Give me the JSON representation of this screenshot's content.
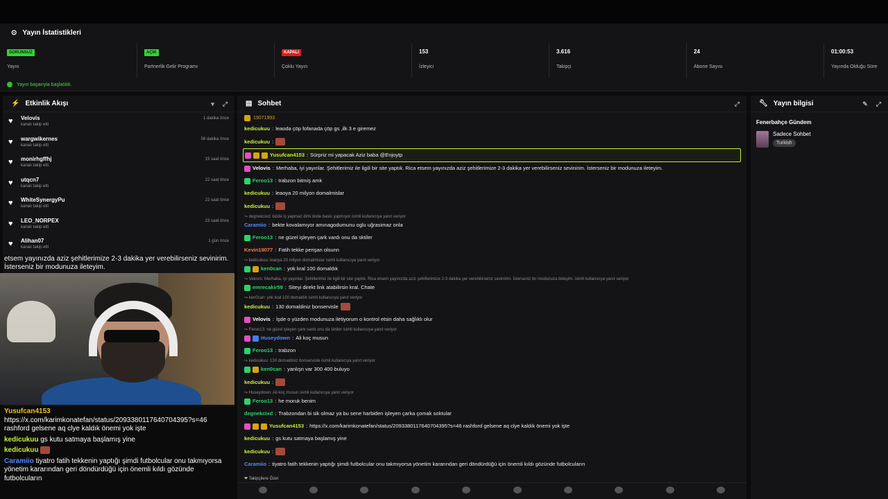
{
  "stats": {
    "title": "Yayın İstatistikleri",
    "items": [
      {
        "badge": "SORUNSUZ",
        "badge_color": "#36d336",
        "label": "Yayın"
      },
      {
        "badge": "AÇIK",
        "badge_color": "#36d336",
        "label": "Partnerlik Gelir Programı"
      },
      {
        "badge": "KAPALI",
        "badge_color": "#d92020",
        "label": "Çoklu Yayın"
      },
      {
        "value": "153",
        "label": "İzleyici"
      },
      {
        "value": "3.616",
        "label": "Takipçi"
      },
      {
        "value": "24",
        "label": "Abone Sayısı"
      },
      {
        "value": "01:00:53",
        "label": "Yayında Olduğu Süre"
      }
    ],
    "status": "Yayın başarıyla başlatıldı."
  },
  "activity": {
    "title": "Etkinlik Akışı",
    "items": [
      {
        "name": "Velovis",
        "sub": "kanalı takip etti",
        "time": "1 dakika önce"
      },
      {
        "name": "wargwikernes",
        "sub": "kanalı takip etti",
        "time": "56 dakika önce"
      },
      {
        "name": "monirhgffhj",
        "sub": "kanalı takip etti",
        "time": "15 saat önce"
      },
      {
        "name": "utqcn7",
        "sub": "kanalı takip etti",
        "time": "22 saat önce"
      },
      {
        "name": "WhiteSynergyPu",
        "sub": "kanalı takip etti",
        "time": "22 saat önce"
      },
      {
        "name": "LEO_NORPEX",
        "sub": "kanalı takip etti",
        "time": "23 saat önce"
      },
      {
        "name": "Alihan07",
        "sub": "kanalı takip etti",
        "time": "1 gün önce"
      }
    ]
  },
  "overlay": {
    "alert_text": "etsem yayınızda aziz şehitlerimize 2-3 dakika yer verebilirseniz sevinirim. İsterseniz bir modunuza ileteyim.",
    "chat": [
      {
        "user": "Yusufcan4153",
        "color": "#f0c419",
        "text": "https://x.com/karimkonatefan/status/2093380117640704395?s=46 rashford gelsene aq clye kaldık önemi yok işte"
      },
      {
        "user": "kedicukuu",
        "color": "#c7f03c",
        "text": "gs kutu satmaya başlamış yine"
      },
      {
        "user": "kedicukuu",
        "color": "#c7f03c",
        "text": ""
      },
      {
        "user": "Caramiio",
        "color": "#4e8cff",
        "text": "tiyatro fatih tekkenin yaptığı şimdi futbolcular onu takmıyorsa yönetim kararından geri döndürdüğü için önemli kıldı gözünde futbolcuların"
      }
    ]
  },
  "chat": {
    "title": "Sohbet",
    "pinned": "19071993",
    "messages": [
      {
        "user": "kedicukuu",
        "color": "#c7f03c",
        "text": "leaoda çöp fofanada çöp gs ,ilk 3 e giremez"
      },
      {
        "user": "kedicukuu",
        "color": "#c7f03c",
        "text": "",
        "emote": true
      },
      {
        "user": "Yusufcan4153",
        "color": "#c7f03c",
        "text": "Sürpriz mi yapacak Aziz baba @Enjoytp",
        "highlight": true,
        "badges": [
          "vip",
          "gift",
          "gift"
        ]
      },
      {
        "user": "Velovis",
        "color": "#ffffff",
        "text": "Merhaba, iyi yayınlar. Şehitlerimiz ile ilgili bir site yaptık. Rica etsem yayınızda aziz şehitlerimize 2-3 dakika yer verebilirseniz sevinirim. İsterseniz bir modunuza ileteyim.",
        "badges": [
          "vip"
        ]
      },
      {
        "user": "Feroo13",
        "color": "#2dd36a",
        "text": "trabzon bitmiş amk",
        "badges": [
          "mod"
        ]
      },
      {
        "user": "kedicukuu",
        "color": "#c7f03c",
        "text": "leaoya 20 milyon domalmislar"
      },
      {
        "user": "kedicukuu",
        "color": "#c7f03c",
        "text": "",
        "emote": true
      },
      {
        "reply": "degnekcixd: bizde iş yapmaz dimi önde baskı yapmıyor isimli kullanıcıya yanıt veriyor"
      },
      {
        "user": "Caramiio",
        "color": "#4e8cff",
        "text": "bekte kovalamıyor amınagodumunu oglu uğrasimaz onla"
      },
      {
        "user": "Feroo13",
        "color": "#2dd36a",
        "text": "ne güzel işleyen çark vardı onu da sktiler",
        "badges": [
          "mod"
        ]
      },
      {
        "user": "Kevin19077",
        "color": "#ff7a4a",
        "text": "Fatih tekke perişan olsunn"
      },
      {
        "reply": "kedicukuu: leaoya 20 milyon domalmislar isimli kullanıcıya yanıt veriyor"
      },
      {
        "user": "ken0can",
        "color": "#2dd36a",
        "text": "yok kral 100 domaldık",
        "badges": [
          "mod",
          "gift"
        ]
      },
      {
        "reply": "Velovis: Merhaba, iyi yayınlar. Şehitlerimiz ile ilgili bir site yaptık. Rica etsem yayınızda aziz şehitlerimize 2-3 dakika yer verebilirseniz sevinirim. İsterseniz bir modunuza ileteyim. isimli kullanıcıya yanıt veriyor"
      },
      {
        "user": "emrecakir59",
        "color": "#2dd36a",
        "text": "Siteyi direkt link atabilirsin kral. Chate",
        "badges": [
          "mod"
        ]
      },
      {
        "reply": "ken0can: yok kral 100 domaldık isimli kullanıcıya yanıt veriyor"
      },
      {
        "user": "kedicukuu",
        "color": "#c7f03c",
        "text": "130 domaldiniz bonservisle",
        "emote": true
      },
      {
        "user": "Velovis",
        "color": "#ffffff",
        "text": "İşde o yüzden modunuza iletiyorum o kontrol etsin daha sağlıklı olur",
        "badges": [
          "vip"
        ]
      },
      {
        "reply": "Feroo13: ne güzel işleyen çark vardı onu da sktiler isimli kullanıcıya yanıt veriyor"
      },
      {
        "user": "Huseydown",
        "color": "#4e8cff",
        "text": "Ali koç musun",
        "badges": [
          "vip",
          "sub"
        ]
      },
      {
        "user": "Feroo13",
        "color": "#2dd36a",
        "text": "trabzon",
        "badges": [
          "mod"
        ]
      },
      {
        "reply": "kedicukuu: 130 domaldiniz bonservisle isimli kullanıcıya yanıt veriyor"
      },
      {
        "user": "ken0can",
        "color": "#2dd36a",
        "text": "yanlışn var 300 400 buluyo",
        "badges": [
          "mod",
          "gift"
        ]
      },
      {
        "user": "kedicukuu",
        "color": "#c7f03c",
        "text": "",
        "emote": true
      },
      {
        "reply": "Huseydown: Ali koç musun isimli kullanıcıya yanıt veriyor"
      },
      {
        "user": "Feroo13",
        "color": "#2dd36a",
        "text": "he moruk benim",
        "badges": [
          "mod"
        ]
      },
      {
        "user": "degnekcixd",
        "color": "#2dd36a",
        "text": "Trabzondan bi sik olmaz ya bu sene harbiden işleyen çarka çomak soktular"
      },
      {
        "user": "Yusufcan4153",
        "color": "#c7f03c",
        "text": "https://x.com/karimkonatefan/status/2093380117640704395?s=46 rashford gelsene aq clye kaldık önemi yok işte",
        "badges": [
          "vip",
          "gift",
          "gift"
        ]
      },
      {
        "user": "kedicukuu",
        "color": "#c7f03c",
        "text": "gs kutu satmaya başlamış yine"
      },
      {
        "user": "kedicukuu",
        "color": "#c7f03c",
        "text": "",
        "emote": true
      },
      {
        "user": "Caramiio",
        "color": "#4e8cff",
        "text": "tiyatro fatih tekkenin yaptığı şimdi futbolcular onu takmıyorsa yönetim kararından geri döndürdüğü için önemli kıldı gözünde futbolcuların"
      }
    ],
    "followers_only": "Takipçilere Özel"
  },
  "info": {
    "title": "Yayın bilgisi",
    "stream_title": "Fenerbahçe Gündem",
    "category": "Sadece Sohbet",
    "tag": "Turkish"
  }
}
